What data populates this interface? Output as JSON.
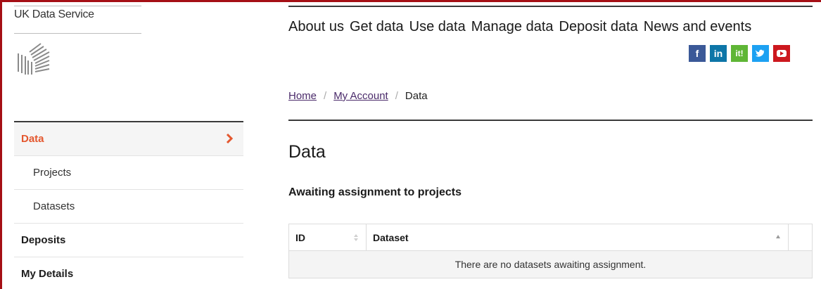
{
  "brand": {
    "name": "UK Data Service"
  },
  "main_nav": {
    "items": [
      "About us",
      "Get data",
      "Use data",
      "Manage data",
      "Deposit data",
      "News and events"
    ]
  },
  "social": {
    "items": [
      {
        "name": "facebook",
        "glyph": "f",
        "color": "#3b5998"
      },
      {
        "name": "linkedin",
        "glyph": "in",
        "color": "#0e76a8"
      },
      {
        "name": "iti",
        "glyph": "it!",
        "color": "#5fb636"
      },
      {
        "name": "twitter",
        "glyph": "🐦",
        "color": "#1da1f2"
      },
      {
        "name": "youtube",
        "glyph": "▶",
        "color": "#cc181e"
      }
    ]
  },
  "breadcrumb": {
    "home": "Home",
    "account": "My Account",
    "current": "Data",
    "separator": "/"
  },
  "sidebar": {
    "items": [
      {
        "label": "Data",
        "type": "top",
        "active": true
      },
      {
        "label": "Projects",
        "type": "sub"
      },
      {
        "label": "Datasets",
        "type": "sub"
      },
      {
        "label": "Deposits",
        "type": "top"
      },
      {
        "label": "My Details",
        "type": "top"
      }
    ]
  },
  "main": {
    "title": "Data",
    "section_title": "Awaiting assignment to projects",
    "table": {
      "headers": [
        "ID",
        "Dataset",
        ""
      ],
      "empty_message": "There are no datasets awaiting assignment."
    }
  },
  "colors": {
    "accent": "#e4572e",
    "frame": "#a50f15",
    "link": "#4a2a6a"
  }
}
